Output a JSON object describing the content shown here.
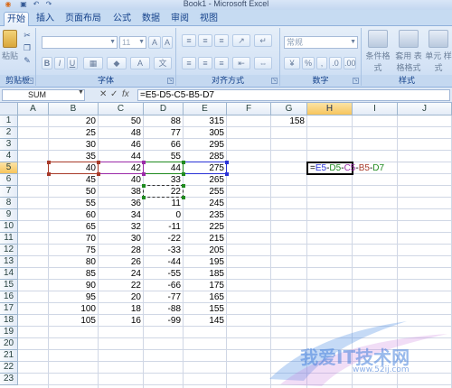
{
  "window": {
    "title": "Book1 - Microsoft Excel"
  },
  "ribbon": {
    "tabs": [
      "开始",
      "插入",
      "页面布局",
      "公式",
      "数据",
      "审阅",
      "视图"
    ],
    "active_tab": "开始",
    "font_size": "11",
    "number_format": "常规",
    "groups": {
      "clipboard": "剪贴板",
      "font": "字体",
      "alignment": "对齐方式",
      "number": "数字",
      "styles": "样式"
    },
    "paste_label": "粘贴",
    "percent_symbol": "%",
    "comma_symbol": ",",
    "styles_buttons": [
      "条件格式",
      "套用 表格格式",
      "单元 样式"
    ]
  },
  "formula_bar": {
    "name_box": "SUM",
    "formula": "=E5-D5-C5-B5-D7",
    "cancel_symbol": "✕",
    "enter_symbol": "✓",
    "fx_symbol": "fx"
  },
  "sheet": {
    "columns": [
      "A",
      "B",
      "C",
      "D",
      "E",
      "F",
      "G",
      "H",
      "I",
      "J"
    ],
    "selected_column": "H",
    "selected_row": 5,
    "row_count": 23,
    "data": [
      {
        "row": 1,
        "B": "20",
        "C": "50",
        "D": "88",
        "E": "315",
        "G": "158"
      },
      {
        "row": 2,
        "B": "25",
        "C": "48",
        "D": "77",
        "E": "305"
      },
      {
        "row": 3,
        "B": "30",
        "C": "46",
        "D": "66",
        "E": "295"
      },
      {
        "row": 4,
        "B": "35",
        "C": "44",
        "D": "55",
        "E": "285"
      },
      {
        "row": 5,
        "B": "40",
        "C": "42",
        "D": "44",
        "E": "275"
      },
      {
        "row": 6,
        "B": "45",
        "C": "40",
        "D": "33",
        "E": "265"
      },
      {
        "row": 7,
        "B": "50",
        "C": "38",
        "D": "22",
        "E": "255"
      },
      {
        "row": 8,
        "B": "55",
        "C": "36",
        "D": "11",
        "E": "245"
      },
      {
        "row": 9,
        "B": "60",
        "C": "34",
        "D": "0",
        "E": "235"
      },
      {
        "row": 10,
        "B": "65",
        "C": "32",
        "D": "-11",
        "E": "225"
      },
      {
        "row": 11,
        "B": "70",
        "C": "30",
        "D": "-22",
        "E": "215"
      },
      {
        "row": 12,
        "B": "75",
        "C": "28",
        "D": "-33",
        "E": "205"
      },
      {
        "row": 13,
        "B": "80",
        "C": "26",
        "D": "-44",
        "E": "195"
      },
      {
        "row": 14,
        "B": "85",
        "C": "24",
        "D": "-55",
        "E": "185"
      },
      {
        "row": 15,
        "B": "90",
        "C": "22",
        "D": "-66",
        "E": "175"
      },
      {
        "row": 16,
        "B": "95",
        "C": "20",
        "D": "-77",
        "E": "165"
      },
      {
        "row": 17,
        "B": "100",
        "C": "18",
        "D": "-88",
        "E": "155"
      },
      {
        "row": 18,
        "B": "105",
        "C": "16",
        "D": "-99",
        "E": "145"
      }
    ],
    "active_cell_formula_parts": [
      {
        "text": "=",
        "color": "#000000"
      },
      {
        "text": "E5",
        "color": "#2a33d6"
      },
      {
        "text": "-",
        "color": "#000000"
      },
      {
        "text": "D5",
        "color": "#1f8a1f"
      },
      {
        "text": "-",
        "color": "#000000"
      },
      {
        "text": "C5",
        "color": "#9b2aa8"
      },
      {
        "text": "-",
        "color": "#000000"
      },
      {
        "text": "B5",
        "color": "#a83a2a"
      },
      {
        "text": "-",
        "color": "#000000"
      },
      {
        "text": "D7",
        "color": "#1f8a1f"
      }
    ],
    "reference_colors": {
      "E5": "#2a33d6",
      "D5": "#1f8a1f",
      "C5": "#9b2aa8",
      "B5": "#a83a2a",
      "D7": "#1f8a1f"
    }
  },
  "watermark": {
    "text": "我爱IT技术网",
    "url": "www.52ij.com"
  }
}
